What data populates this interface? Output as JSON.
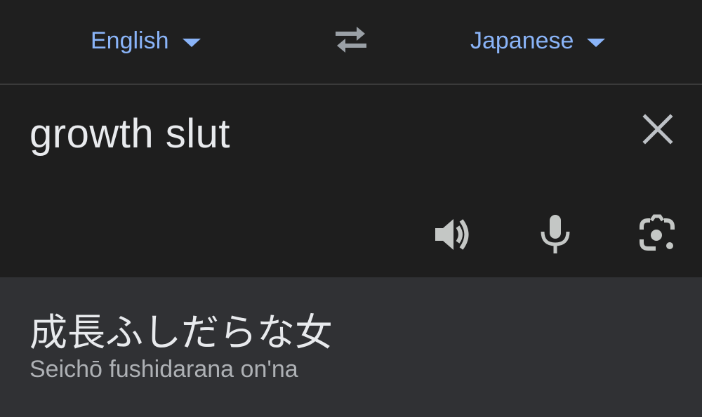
{
  "language_bar": {
    "source_language": "English",
    "target_language": "Japanese",
    "swap_icon": "swap-arrows-icon",
    "dropdown_icon": "caret-down-icon"
  },
  "input": {
    "text": "growth slut",
    "clear_icon": "close-icon",
    "tools": [
      "speaker-icon",
      "microphone-icon",
      "camera-icon"
    ]
  },
  "output": {
    "translation": "成長ふしだらな女",
    "romanization": "Seichō fushidarana on'na"
  },
  "colors": {
    "background": "#1e1e1e",
    "output_background": "#303134",
    "accent": "#8ab4f8",
    "primary_text": "#e8eaed",
    "secondary_text": "#aeb1b5",
    "icon": "#c4c7c5",
    "divider": "#3a3a3a"
  }
}
